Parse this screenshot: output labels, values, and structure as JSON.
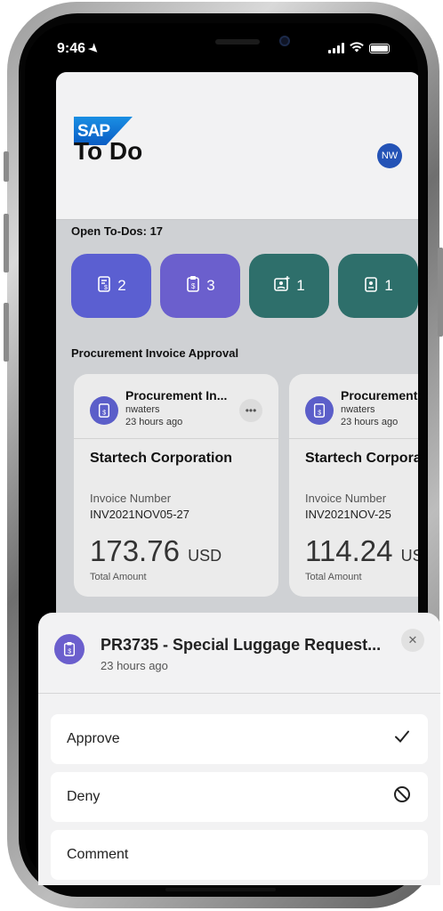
{
  "status_bar": {
    "time": "9:46"
  },
  "header": {
    "logo_text": "SAP",
    "avatar_initials": "NW",
    "title": "To Do"
  },
  "summary": {
    "open_label": "Open To-Dos: 17",
    "tiles": [
      {
        "count": "2",
        "color": "#5b5fd1",
        "icon": "invoice-icon"
      },
      {
        "count": "3",
        "color": "#6b5fcd",
        "icon": "clipboard-money-icon"
      },
      {
        "count": "1",
        "color": "#2e6f6b",
        "icon": "add-contact-icon"
      },
      {
        "count": "1",
        "color": "#2e6f6b",
        "icon": "badge-icon"
      }
    ]
  },
  "section": {
    "title": "Procurement Invoice Approval"
  },
  "cards": [
    {
      "title": "Procurement In...",
      "user": "nwaters",
      "time": "23 hours ago",
      "company": "Startech Corporation",
      "invoice_label": "Invoice Number",
      "invoice_number": "INV2021NOV05-27",
      "amount": "173.76",
      "currency": "USD",
      "amount_label": "Total Amount"
    },
    {
      "title": "Procurement",
      "user": "nwaters",
      "time": "23 hours ago",
      "company": "Startech Corpora",
      "invoice_label": "Invoice Number",
      "invoice_number": "INV2021NOV-25",
      "amount": "114.24",
      "currency": "USD",
      "amount_label": "Total Amount"
    }
  ],
  "sheet": {
    "title": "PR3735 - Special Luggage Request...",
    "time": "23 hours ago",
    "actions": [
      {
        "label": "Approve",
        "icon": "checkmark-icon"
      },
      {
        "label": "Deny",
        "icon": "prohibited-icon"
      },
      {
        "label": "Comment",
        "icon": ""
      }
    ]
  }
}
